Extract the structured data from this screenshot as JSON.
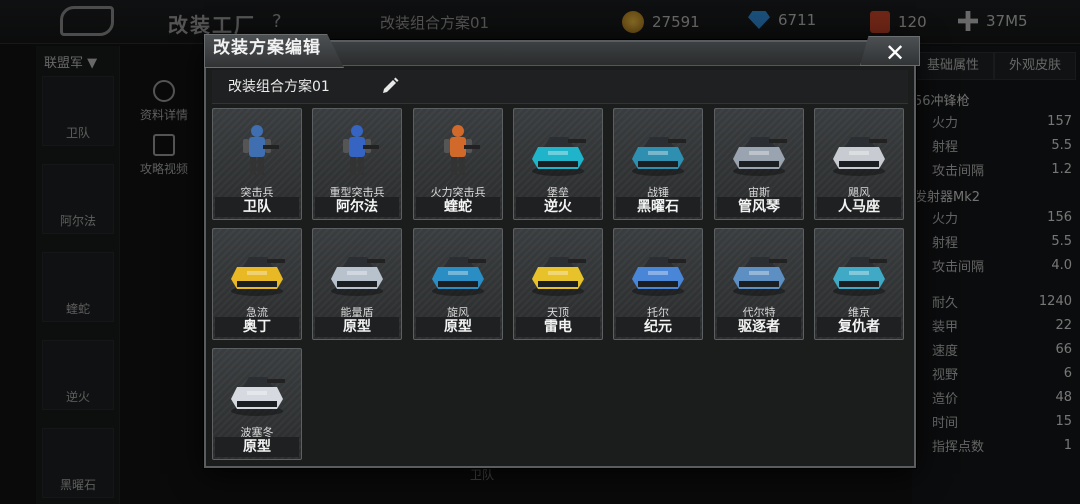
{
  "background": {
    "title": "改装工厂",
    "help": "?",
    "plan_label": "改装组合方案01",
    "resources": [
      {
        "icon": "gold-coin-icon",
        "value": "27591"
      },
      {
        "icon": "diamond-icon",
        "value": "6711"
      },
      {
        "icon": "fuel-icon",
        "value": "120"
      },
      {
        "icon": "add-icon",
        "value": "37M5"
      }
    ],
    "filter": "联盟军 ▼",
    "left_units": [
      "卫队",
      "阿尔法",
      "蝰蛇",
      "逆火",
      "黑曜石"
    ],
    "side_actions": [
      "资料详情",
      "攻略视频"
    ],
    "tabs": [
      "基础属性",
      "外观皮肤"
    ],
    "sections": [
      "56冲锋枪",
      "发射器Mk2"
    ],
    "weapon1": [
      {
        "label": "火力",
        "value": "157"
      },
      {
        "label": "射程",
        "value": "5.5"
      },
      {
        "label": "攻击间隔",
        "value": "1.2"
      }
    ],
    "weapon2": [
      {
        "label": "火力",
        "value": "156"
      },
      {
        "label": "射程",
        "value": "5.5"
      },
      {
        "label": "攻击间隔",
        "value": "4.0"
      }
    ],
    "stats": [
      {
        "label": "耐久",
        "value": "1240"
      },
      {
        "label": "装甲",
        "value": "22"
      },
      {
        "label": "速度",
        "value": "66"
      },
      {
        "label": "视野",
        "value": "6"
      },
      {
        "label": "造价",
        "value": "48"
      },
      {
        "label": "时间",
        "value": "15"
      },
      {
        "label": "指挥点数",
        "value": "1"
      }
    ],
    "bottom_label": "卫队"
  },
  "dialog": {
    "title": "改装方案编辑",
    "close": "✕",
    "plan_name": "改装组合方案01"
  },
  "units": [
    {
      "type": "突击兵",
      "name": "卫队",
      "color": "#3f6fb0"
    },
    {
      "type": "重型突击兵",
      "name": "阿尔法",
      "color": "#3564c2"
    },
    {
      "type": "火力突击兵",
      "name": "蝰蛇",
      "color": "#d0692a"
    },
    {
      "type": "堡垒",
      "name": "逆火",
      "color": "#1fb4c9"
    },
    {
      "type": "战锤",
      "name": "黑曜石",
      "color": "#2e8fb0"
    },
    {
      "type": "宙斯",
      "name": "管风琴",
      "color": "#9aa3b0"
    },
    {
      "type": "飓风",
      "name": "人马座",
      "color": "#c8ccd2"
    },
    {
      "type": "急流",
      "name": "奥丁",
      "color": "#e8b825"
    },
    {
      "type": "能量盾",
      "name": "原型",
      "color": "#b8c2cc"
    },
    {
      "type": "旋风",
      "name": "原型",
      "color": "#2a8ec4"
    },
    {
      "type": "天顶",
      "name": "雷电",
      "color": "#e8c22a"
    },
    {
      "type": "托尔",
      "name": "纪元",
      "color": "#4a86d8"
    },
    {
      "type": "代尔特",
      "name": "驱逐者",
      "color": "#5d8fc2"
    },
    {
      "type": "维京",
      "name": "复仇者",
      "color": "#3fa9c6"
    },
    {
      "type": "波塞冬",
      "name": "原型",
      "color": "#d6dae0"
    }
  ]
}
